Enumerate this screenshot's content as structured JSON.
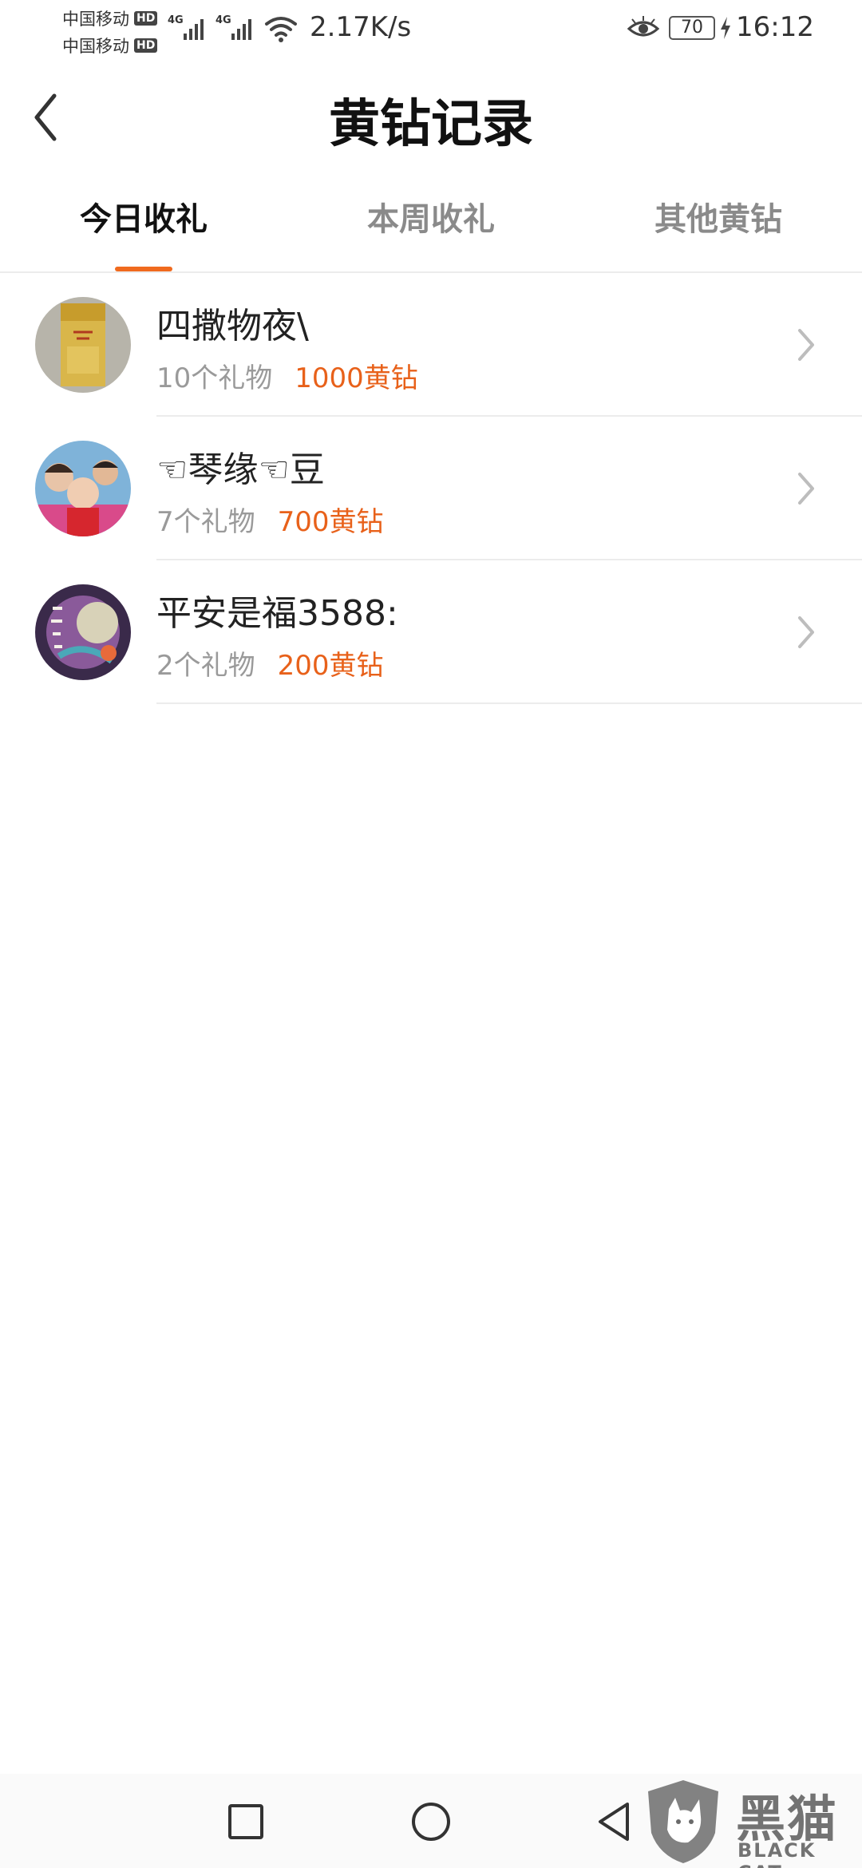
{
  "status_bar": {
    "carrier_1": "中国移动",
    "carrier_2": "中国移动",
    "hd_badge": "HD",
    "network_type": "4G",
    "net_speed": "2.17K/s",
    "battery_level": "70",
    "time": "16:12"
  },
  "header": {
    "title": "黄钻记录"
  },
  "tabs": [
    {
      "label": "今日收礼",
      "active": true
    },
    {
      "label": "本周收礼",
      "active": false
    },
    {
      "label": "其他黄钻",
      "active": false
    }
  ],
  "records": [
    {
      "name": "四撒物夜\\",
      "gift_count": "10个礼物",
      "diamonds": "1000黄钻"
    },
    {
      "name": "☜琴缘☜豆",
      "gift_count": "7个礼物",
      "diamonds": "700黄钻"
    },
    {
      "name": "平安是福3588:",
      "gift_count": "2个礼物",
      "diamonds": "200黄钻"
    }
  ],
  "watermark": {
    "title": "黑猫",
    "subtitle": "BLACK CAT"
  },
  "colors": {
    "accent": "#f06a1e",
    "diamond_text": "#e8611a",
    "muted_text": "#9a9a9a"
  }
}
